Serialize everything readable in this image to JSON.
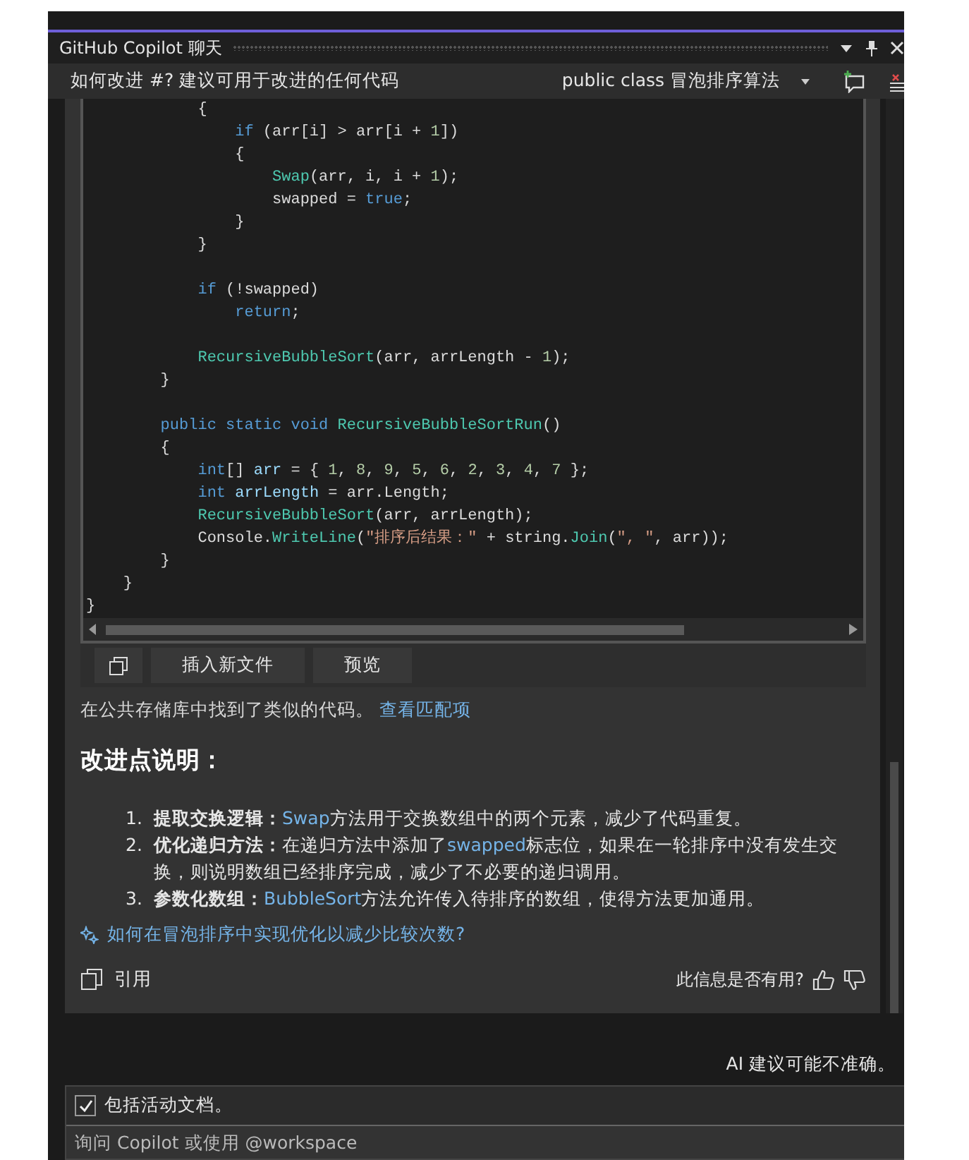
{
  "window": {
    "title": "GitHub Copilot 聊天"
  },
  "toolbar": {
    "question": "如何改进 #? 建议可用于改进的任何代码",
    "scope": "public class 冒泡排序算法"
  },
  "code": [
    {
      "tokens": [
        {
          "kind": "plain",
          "text": "            {"
        }
      ]
    },
    {
      "tokens": [
        {
          "kind": "keyword",
          "text": "                if"
        },
        {
          "kind": "plain",
          "text": " (arr[i] > arr[i + "
        },
        {
          "kind": "number",
          "text": "1"
        },
        {
          "kind": "plain",
          "text": "])"
        }
      ]
    },
    {
      "tokens": [
        {
          "kind": "plain",
          "text": "                {"
        }
      ]
    },
    {
      "tokens": [
        {
          "kind": "method",
          "text": "                    Swap"
        },
        {
          "kind": "plain",
          "text": "(arr, i, i + "
        },
        {
          "kind": "number",
          "text": "1"
        },
        {
          "kind": "plain",
          "text": ");"
        }
      ]
    },
    {
      "tokens": [
        {
          "kind": "plain",
          "text": "                    swapped = "
        },
        {
          "kind": "keyword",
          "text": "true"
        },
        {
          "kind": "plain",
          "text": ";"
        }
      ]
    },
    {
      "tokens": [
        {
          "kind": "plain",
          "text": "                }"
        }
      ]
    },
    {
      "tokens": [
        {
          "kind": "plain",
          "text": "            }"
        }
      ]
    },
    {
      "blank_before": true,
      "tokens": [
        {
          "kind": "keyword",
          "text": "            if"
        },
        {
          "kind": "plain",
          "text": " (!swapped)"
        }
      ]
    },
    {
      "tokens": [
        {
          "kind": "keyword",
          "text": "                return"
        },
        {
          "kind": "plain",
          "text": ";"
        }
      ]
    },
    {
      "blank_before": true,
      "tokens": [
        {
          "kind": "method",
          "text": "            RecursiveBubbleSort"
        },
        {
          "kind": "plain",
          "text": "(arr, arrLength - "
        },
        {
          "kind": "number",
          "text": "1"
        },
        {
          "kind": "plain",
          "text": ");"
        }
      ]
    },
    {
      "tokens": [
        {
          "kind": "plain",
          "text": "        }"
        }
      ]
    },
    {
      "blank_before": true,
      "tokens": [
        {
          "kind": "keyword",
          "text": "        public static void"
        },
        {
          "kind": "method",
          "text": " RecursiveBubbleSortRun"
        },
        {
          "kind": "plain",
          "text": "()"
        }
      ]
    },
    {
      "tokens": [
        {
          "kind": "plain",
          "text": "        {"
        }
      ]
    },
    {
      "tokens": [
        {
          "kind": "keyword",
          "text": "            int"
        },
        {
          "kind": "plain",
          "text": "[] "
        },
        {
          "kind": "variable",
          "text": "arr"
        },
        {
          "kind": "plain",
          "text": " = { "
        },
        {
          "kind": "number",
          "text": "1"
        },
        {
          "kind": "plain",
          "text": ", "
        },
        {
          "kind": "number",
          "text": "8"
        },
        {
          "kind": "plain",
          "text": ", "
        },
        {
          "kind": "number",
          "text": "9"
        },
        {
          "kind": "plain",
          "text": ", "
        },
        {
          "kind": "number",
          "text": "5"
        },
        {
          "kind": "plain",
          "text": ", "
        },
        {
          "kind": "number",
          "text": "6"
        },
        {
          "kind": "plain",
          "text": ", "
        },
        {
          "kind": "number",
          "text": "2"
        },
        {
          "kind": "plain",
          "text": ", "
        },
        {
          "kind": "number",
          "text": "3"
        },
        {
          "kind": "plain",
          "text": ", "
        },
        {
          "kind": "number",
          "text": "4"
        },
        {
          "kind": "plain",
          "text": ", "
        },
        {
          "kind": "number",
          "text": "7"
        },
        {
          "kind": "plain",
          "text": " };"
        }
      ]
    },
    {
      "tokens": [
        {
          "kind": "keyword",
          "text": "            int"
        },
        {
          "kind": "variable",
          "text": " arrLength"
        },
        {
          "kind": "plain",
          "text": " = arr.Length;"
        }
      ]
    },
    {
      "tokens": [
        {
          "kind": "method",
          "text": "            RecursiveBubbleSort"
        },
        {
          "kind": "plain",
          "text": "(arr, arrLength);"
        }
      ]
    },
    {
      "tokens": [
        {
          "kind": "plain",
          "text": "            Console."
        },
        {
          "kind": "method",
          "text": "WriteLine"
        },
        {
          "kind": "plain",
          "text": "("
        },
        {
          "kind": "string",
          "text": "\"排序后结果：\""
        },
        {
          "kind": "plain",
          "text": " + string."
        },
        {
          "kind": "method",
          "text": "Join"
        },
        {
          "kind": "plain",
          "text": "("
        },
        {
          "kind": "string",
          "text": "\", \""
        },
        {
          "kind": "plain",
          "text": ", arr));"
        }
      ]
    },
    {
      "tokens": [
        {
          "kind": "plain",
          "text": "        }"
        }
      ]
    },
    {
      "tokens": [
        {
          "kind": "plain",
          "text": "    }"
        }
      ]
    },
    {
      "tokens": [
        {
          "kind": "plain",
          "text": "}"
        }
      ]
    }
  ],
  "code_actions": [
    "插入新文件",
    "预览"
  ],
  "match_note": {
    "text": "在公共存储库中找到了类似的代码。",
    "link": "查看匹配项"
  },
  "heading": "改进点说明：",
  "points": [
    {
      "marker": "1.",
      "term": "提取交换逻辑：",
      "parts": [
        {
          "kind": "code",
          "text": "Swap"
        },
        {
          "kind": "plain",
          "text": "方法用于交换数组中的两个元素，减少了代码重复。"
        }
      ]
    },
    {
      "marker": "2.",
      "term": "优化递归方法：",
      "parts": [
        {
          "kind": "plain",
          "text": "在递归方法中添加了"
        },
        {
          "kind": "code",
          "text": "swapped"
        },
        {
          "kind": "plain",
          "text": "标志位，如果在一轮排序中没有发生交换，则说明数组已经排序完成，减少了不必要的递归调用。"
        }
      ]
    },
    {
      "marker": "3.",
      "term": "参数化数组：",
      "parts": [
        {
          "kind": "code",
          "text": "BubbleSort"
        },
        {
          "kind": "plain",
          "text": "方法允许传入待排序的数组，使得方法更加通用。"
        }
      ]
    }
  ],
  "suggestion": "如何在冒泡排序中实现优化以减少比较次数?",
  "reference": "引用",
  "feedback": "此信息是否有用?",
  "disclaimer": "AI 建议可能不准确。",
  "include_active_doc": {
    "label": "包括活动文档。",
    "checked": true
  },
  "input": {
    "placeholder": "询问 Copilot 或使用 @workspace"
  }
}
